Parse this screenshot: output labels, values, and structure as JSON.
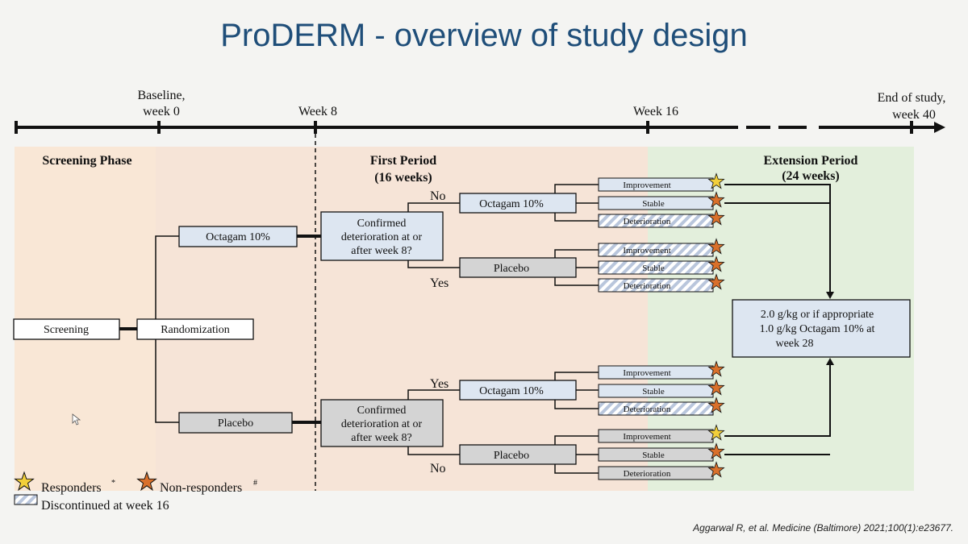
{
  "title": "ProDERM - overview of study design",
  "citation": "Aggarwal R, et al. Medicine (Baltimore) 2021;100(1):e23677.",
  "timeline": {
    "baseline": [
      "Baseline,",
      "week 0"
    ],
    "week8": "Week 8",
    "week16": "Week 16",
    "end": [
      "End of study,",
      "week 40"
    ]
  },
  "phases": {
    "screening": "Screening Phase",
    "first": [
      "First Period",
      "(16 weeks)"
    ],
    "extension": [
      "Extension Period",
      "(24 weeks)"
    ]
  },
  "nodes": {
    "screening": "Screening",
    "randomization": "Randomization",
    "arm_top": "Octagam 10%",
    "arm_bottom": "Placebo",
    "decision": [
      "Confirmed",
      "deterioration at or",
      "after week 8?"
    ],
    "no": "No",
    "yes": "Yes",
    "octagam": "Octagam 10%",
    "placebo": "Placebo",
    "outcomes": [
      "Improvement",
      "Stable",
      "Deterioration"
    ],
    "extension_box": [
      "2.0 g/kg or if appropriate",
      "1.0 g/kg Octagam 10% at",
      "week 28"
    ]
  },
  "legend": {
    "responders": "Responders",
    "responders_mark": "*",
    "nonresponders": "Non-responders",
    "nonresponders_mark": "#",
    "discontinued": "Discontinued at week 16"
  },
  "colors": {
    "title": "#1f4e79",
    "blue_box": "#dde6f1",
    "grey_box": "#d4d4d4",
    "responder_star": "#f2cf3a",
    "nonresponder_star": "#d9702b"
  }
}
